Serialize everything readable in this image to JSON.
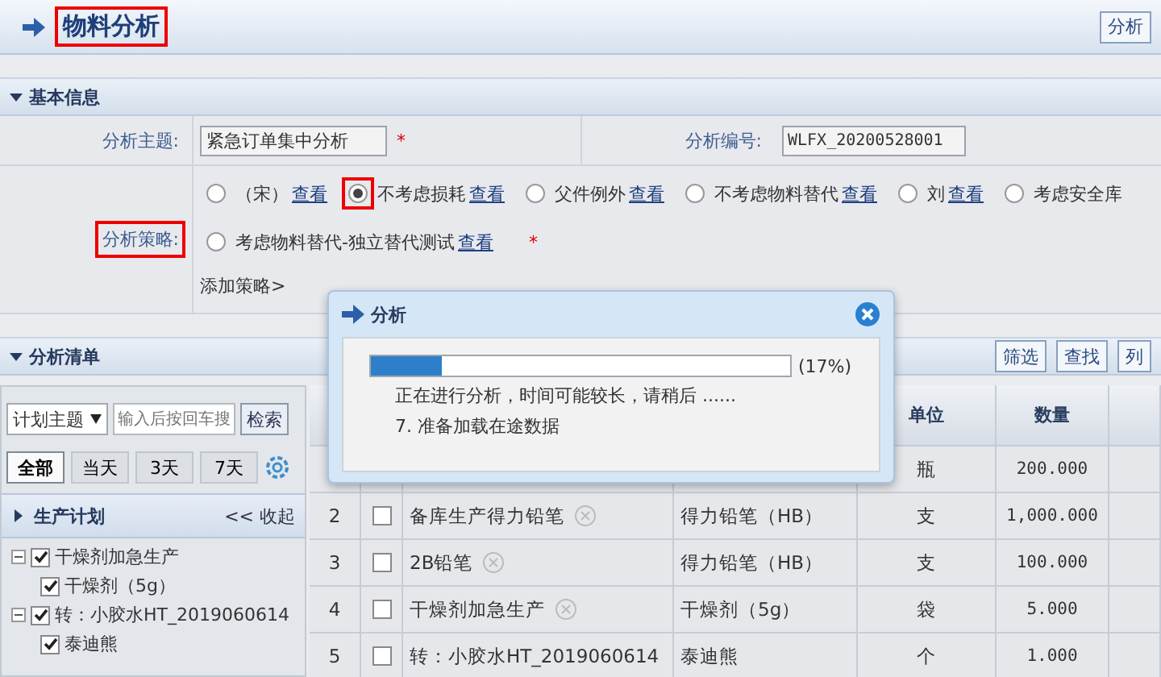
{
  "header": {
    "title": "物料分析",
    "title_highlighted": true,
    "button": "分析"
  },
  "basic_section": {
    "title": "基本信息",
    "expanded": true
  },
  "form": {
    "subject_label": "分析主题:",
    "subject_value": "紧急订单集中分析",
    "subject_required": "*",
    "code_label": "分析编号:",
    "code_value": "WLFX_20200528001",
    "strategy_label": "分析策略:",
    "strategy_label_highlighted": true,
    "strategies": [
      {
        "label": "（宋）",
        "link": "查看",
        "selected": false,
        "highlighted": false
      },
      {
        "label": "不考虑损耗",
        "link": "查看",
        "selected": true,
        "highlighted": true
      },
      {
        "label": "父件例外",
        "link": "查看",
        "selected": false,
        "highlighted": false
      },
      {
        "label": "不考虑物料替代",
        "link": "查看",
        "selected": false,
        "highlighted": false
      },
      {
        "label": "刘",
        "link": "查看",
        "selected": false,
        "highlighted": false
      },
      {
        "label": "考虑安全库",
        "selected": false,
        "highlighted": false
      },
      {
        "label": "考虑物料替代-独立替代测试",
        "link": "查看",
        "selected": false,
        "highlighted": false
      }
    ],
    "strategy_required": "*",
    "add_strategy": "添加策略>"
  },
  "list_section": {
    "title": "分析清单",
    "expanded": true,
    "buttons": [
      "筛选",
      "查找",
      "列"
    ]
  },
  "left_panel": {
    "filter_select": "计划主题",
    "search_placeholder": "输入后按回车搜",
    "search_button": "检索",
    "date_tabs": [
      {
        "label": "全部",
        "selected": true
      },
      {
        "label": "当天",
        "selected": false
      },
      {
        "label": "3天",
        "selected": false
      },
      {
        "label": "7天",
        "selected": false
      }
    ],
    "group_title": "生产计划",
    "collapse": "<< 收起",
    "tree": [
      {
        "label": "干燥剂加急生产",
        "checked": true,
        "expanded": true,
        "children": [
          {
            "label": "干燥剂（5g）",
            "checked": true
          }
        ]
      },
      {
        "label": "转：小胶水HT_2019060614",
        "checked": true,
        "expanded": true,
        "children": [
          {
            "label": "泰迪熊",
            "checked": true
          }
        ]
      }
    ]
  },
  "table": {
    "columns": [
      "",
      "",
      "",
      "",
      "单位",
      "数量",
      ""
    ],
    "rows": [
      {
        "index": "",
        "name": "",
        "material": "",
        "unit": "瓶",
        "quantity": "200.000"
      },
      {
        "index": "2",
        "name": "备库生产得力铅笔",
        "material": "得力铅笔（HB）",
        "unit": "支",
        "quantity": "1,000.000",
        "checked": false
      },
      {
        "index": "3",
        "name": "2B铅笔",
        "material": "得力铅笔（HB）",
        "unit": "支",
        "quantity": "100.000",
        "checked": false
      },
      {
        "index": "4",
        "name": "干燥剂加急生产",
        "material": "干燥剂（5g）",
        "unit": "袋",
        "quantity": "5.000",
        "checked": false
      },
      {
        "index": "5",
        "name": "转：小胶水HT_2019060614",
        "material": "泰迪熊",
        "unit": "个",
        "quantity": "1.000",
        "checked": false
      }
    ]
  },
  "dialog": {
    "title": "分析",
    "level": 0.17,
    "percent": "(17%)",
    "message": "正在进行分析，时间可能较长，请稍后 ......",
    "step": "7. 准备加载在途数据"
  }
}
